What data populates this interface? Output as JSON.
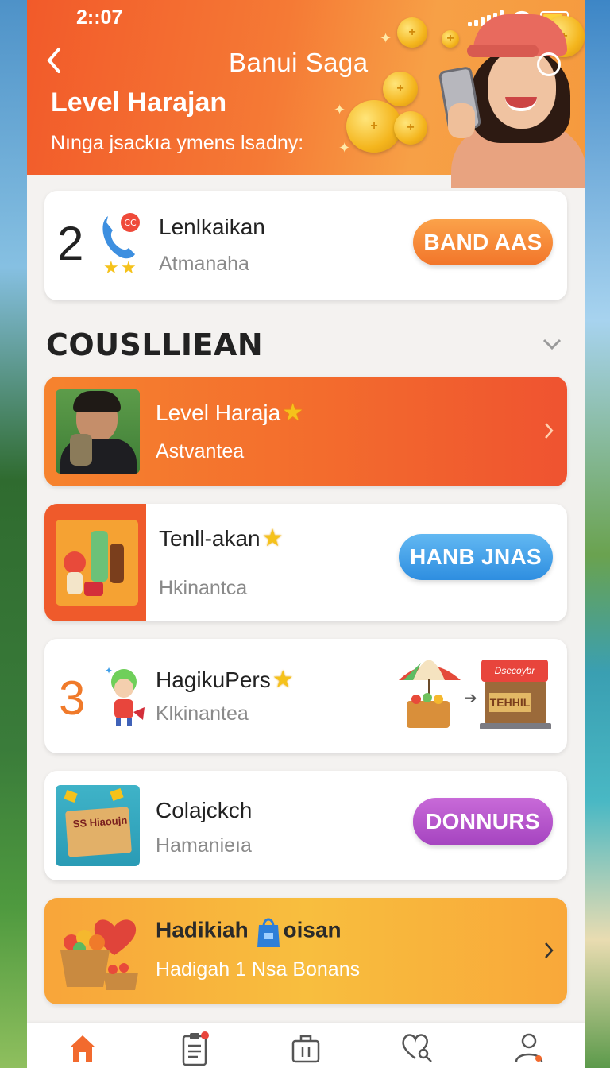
{
  "status_bar": {
    "time": "2::07"
  },
  "header": {
    "app_title": "Banui Saga",
    "title": "Level Harajan",
    "subtitle": "Nınga jsackıa ymens lsadny:",
    "back_icon": "chevron-left-icon",
    "menu_icon": "circle-icon"
  },
  "top_card": {
    "rank": "2",
    "title": "Lenlkaikan",
    "subtitle": "Atmanaha",
    "button_label": "BAND AAS",
    "icon": "phone-chat-icon"
  },
  "section": {
    "title": "COUSLLIEAN"
  },
  "items": [
    {
      "title": "Level Haraja",
      "subtitle": "Astvantea"
    },
    {
      "title": "Tenll-akan",
      "subtitle": "Hkinantca",
      "button_label": "HANB JNAS"
    },
    {
      "rank": "3",
      "title": "HagikuPers",
      "subtitle": "Klkinantea",
      "shop_sign": "Dsecoybr",
      "shop_label": "TEHHIL"
    },
    {
      "title": "Colajckch",
      "subtitle": "Hamanieıa",
      "button_label": "DONNURS",
      "box_label": "SS Hiaoujn"
    },
    {
      "title_part1": "Hadikiah",
      "title_part2": "oisan",
      "subtitle": "Hadigah 1 Nsa Bonans"
    }
  ],
  "colors": {
    "header_orange": "#f25a2a",
    "orange_button": "#f7852f",
    "blue_button": "#3f9ee8",
    "purple_button": "#b054c7",
    "gold_star": "#f5c21b"
  },
  "nav": [
    {
      "icon": "home-icon"
    },
    {
      "icon": "clipboard-icon"
    },
    {
      "icon": "shopping-bag-icon"
    },
    {
      "icon": "heart-search-icon"
    },
    {
      "icon": "profile-icon"
    }
  ]
}
